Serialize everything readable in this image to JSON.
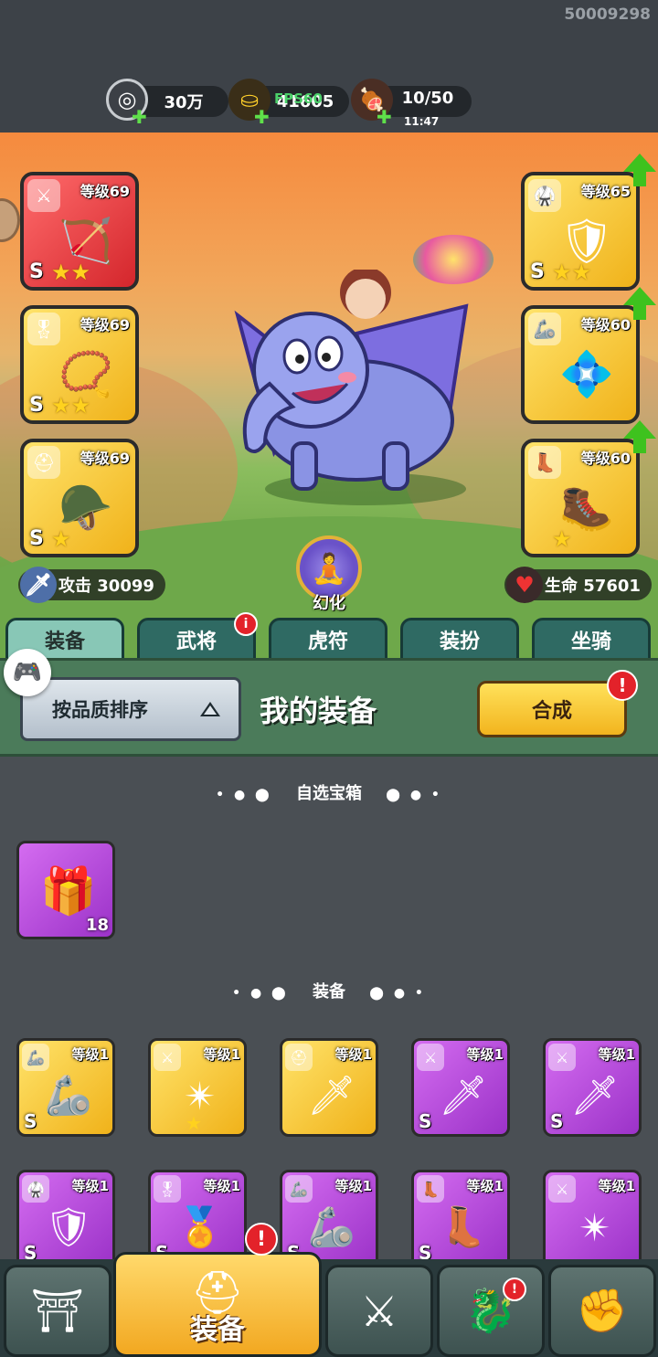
{
  "build_id": "50009298",
  "fps": "FPS60",
  "resources": [
    {
      "icon": "silver-coin-icon",
      "value": "30万"
    },
    {
      "icon": "gold-ingot-icon",
      "value": "41605"
    },
    {
      "icon": "meat-stamina-icon",
      "value": "10/50",
      "sub": "11:47"
    }
  ],
  "equipped_left": [
    {
      "slot": "weapon",
      "type_icon": "sword-icon",
      "level": "等级69",
      "grade": "S",
      "stars": "★★",
      "rarity": "red"
    },
    {
      "slot": "medal",
      "type_icon": "medal-icon",
      "level": "等级69",
      "grade": "S",
      "stars": "★★",
      "rarity": "gold"
    },
    {
      "slot": "helmet",
      "type_icon": "helmet-icon",
      "level": "等级69",
      "grade": "S",
      "stars": "★",
      "rarity": "gold"
    }
  ],
  "equipped_right": [
    {
      "slot": "armor",
      "type_icon": "armor-icon",
      "level": "等级65",
      "grade": "S",
      "stars": "★★",
      "rarity": "gold",
      "upgrade": true
    },
    {
      "slot": "bracer",
      "type_icon": "bracer-icon",
      "level": "等级60",
      "grade": "",
      "stars": "",
      "rarity": "gold",
      "upgrade": true
    },
    {
      "slot": "boots",
      "type_icon": "boots-icon",
      "level": "等级60",
      "grade": "",
      "stars": "★",
      "rarity": "gold",
      "upgrade": true
    }
  ],
  "stats": {
    "attack_label": "攻击 30099",
    "hp_label": "生命 57601"
  },
  "transform_label": "幻化",
  "tabs": [
    {
      "label": "装备",
      "active": true,
      "badge": false
    },
    {
      "label": "武将",
      "active": false,
      "badge": true
    },
    {
      "label": "虎符",
      "active": false,
      "badge": false
    },
    {
      "label": "装扮",
      "active": false,
      "badge": false
    },
    {
      "label": "坐骑",
      "active": false,
      "badge": false
    }
  ],
  "badge_glyph": "i",
  "toolbar": {
    "sort_label": "按品质排序",
    "title": "我的装备",
    "synth_label": "合成",
    "alert_glyph": "!"
  },
  "chest_section": {
    "title": "自选宝箱",
    "items": [
      {
        "icon": "mystery-chest-icon",
        "count": "18",
        "rarity": "purple"
      }
    ]
  },
  "equip_section": {
    "title": "装备",
    "items": [
      {
        "type_icon": "bracer-icon",
        "gfx": "🦾",
        "level": "等级1",
        "grade": "S",
        "stars": "",
        "rarity": "gold"
      },
      {
        "type_icon": "sword-icon",
        "gfx": "✴",
        "level": "等级1",
        "grade": "",
        "stars": "★",
        "rarity": "gold"
      },
      {
        "type_icon": "helmet-icon",
        "gfx": "🗡",
        "level": "等级1",
        "grade": "",
        "stars": "",
        "rarity": "gold"
      },
      {
        "type_icon": "sword-icon",
        "gfx": "🗡",
        "level": "等级1",
        "grade": "S",
        "stars": "",
        "rarity": "purple"
      },
      {
        "type_icon": "sword-icon",
        "gfx": "🗡",
        "level": "等级1",
        "grade": "S",
        "stars": "",
        "rarity": "purple"
      },
      {
        "type_icon": "armor-icon",
        "gfx": "🛡",
        "level": "等级1",
        "grade": "S",
        "stars": "",
        "rarity": "purple"
      },
      {
        "type_icon": "medal-icon",
        "gfx": "🏅",
        "level": "等级1",
        "grade": "S",
        "stars": "",
        "rarity": "purple"
      },
      {
        "type_icon": "bracer-icon",
        "gfx": "🦾",
        "level": "等级1",
        "grade": "S",
        "stars": "",
        "rarity": "purple"
      },
      {
        "type_icon": "boots-icon",
        "gfx": "👢",
        "level": "等级1",
        "grade": "S",
        "stars": "",
        "rarity": "purple"
      },
      {
        "type_icon": "sword-icon",
        "gfx": "✴",
        "level": "等级1",
        "grade": "",
        "stars": "",
        "rarity": "purple"
      }
    ]
  },
  "bottom_nav": [
    {
      "icon": "shop-gate-icon",
      "label": "",
      "active": false,
      "badge": false
    },
    {
      "icon": "helmet-icon",
      "label": "装备",
      "active": true,
      "badge": true
    },
    {
      "icon": "battle-shield-icon",
      "label": "",
      "active": false,
      "badge": false
    },
    {
      "icon": "hero-stars-icon",
      "label": "",
      "active": false,
      "badge": true
    },
    {
      "icon": "fist-upgrade-icon",
      "label": "",
      "active": false,
      "badge": false
    }
  ]
}
